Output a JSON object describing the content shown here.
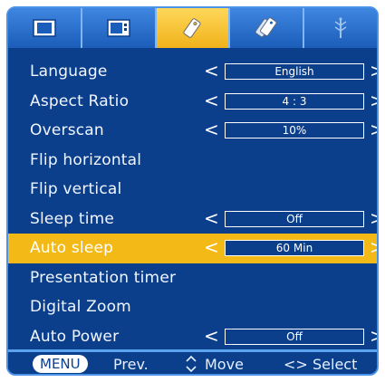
{
  "tabs": [
    {
      "icon": "picture-icon",
      "active": false
    },
    {
      "icon": "screen-icon",
      "active": false
    },
    {
      "icon": "tag-icon",
      "active": true
    },
    {
      "icon": "tags-icon",
      "active": false
    },
    {
      "icon": "input-icon",
      "active": false
    }
  ],
  "menu": {
    "items": [
      {
        "label": "Language",
        "value": "English",
        "has_value": true
      },
      {
        "label": "Aspect Ratio",
        "value": "4 : 3",
        "has_value": true
      },
      {
        "label": "Overscan",
        "value": "10%",
        "has_value": true
      },
      {
        "label": "Flip horizontal",
        "has_value": false
      },
      {
        "label": "Flip vertical",
        "has_value": false
      },
      {
        "label": "Sleep time",
        "value": "Off",
        "has_value": true
      },
      {
        "label": "Auto sleep",
        "value": "60 Min",
        "has_value": true,
        "highlight": true
      },
      {
        "label": "Presentation timer",
        "has_value": false
      },
      {
        "label": "Digital Zoom",
        "has_value": false
      },
      {
        "label": "Auto Power",
        "value": "Off",
        "has_value": true
      }
    ],
    "left_arrow": "<",
    "right_arrow": ">"
  },
  "footer": {
    "menu_key": "MENU",
    "prev_label": "Prev.",
    "move_label": "Move",
    "select_glyph": "<>",
    "select_label": "Select"
  },
  "colors": {
    "background": "#0b3f8c",
    "highlight": "#f3b916",
    "tab_active": "#f0b21a",
    "tab_inactive": "#2f74d2",
    "border": "#4a93e8"
  }
}
